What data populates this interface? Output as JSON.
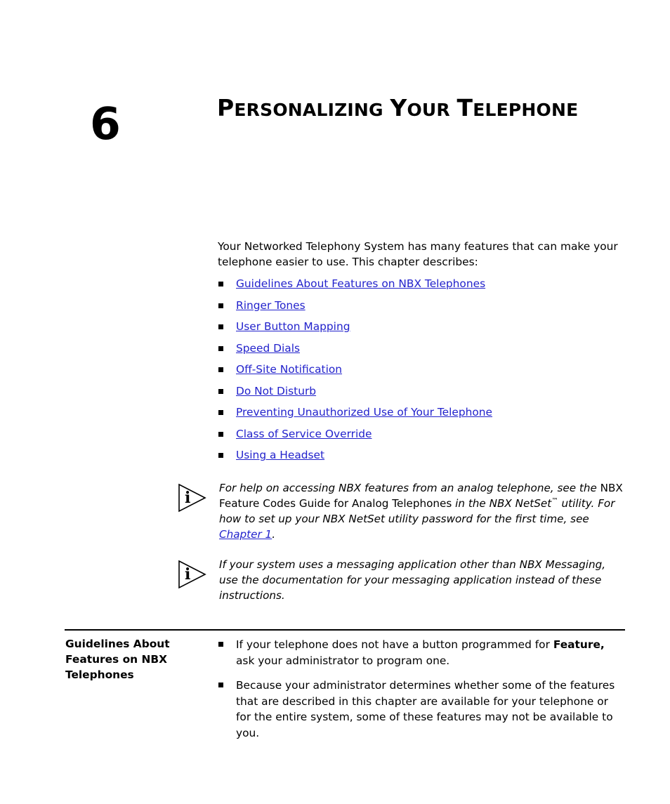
{
  "chapter": {
    "number": "6",
    "title_words": [
      {
        "cap": "P",
        "rest": "ERSONALIZING"
      },
      {
        "cap": "Y",
        "rest": "OUR"
      },
      {
        "cap": "T",
        "rest": "ELEPHONE"
      }
    ],
    "title_plain": "PERSONALIZING YOUR TELEPHONE"
  },
  "intro": {
    "paragraph": "Your Networked Telephony System has many features that can make your telephone easier to use. This chapter describes:"
  },
  "toc_links": [
    {
      "label": "Guidelines About Features on NBX Telephones"
    },
    {
      "label": "Ringer Tones"
    },
    {
      "label": "User Button Mapping"
    },
    {
      "label": "Speed Dials"
    },
    {
      "label": "Off-Site Notification"
    },
    {
      "label": "Do Not Disturb"
    },
    {
      "label": "Preventing Unauthorized Use of Your Telephone"
    },
    {
      "label": "Class of Service Override"
    },
    {
      "label": "Using a Headset"
    }
  ],
  "notes": [
    {
      "icon": "info-note-icon",
      "seg1": "For help on accessing NBX features from an analog telephone, see the ",
      "roman": "NBX Feature Codes Guide for Analog Telephones",
      "seg2": " in the NBX NetSet",
      "trademark": "™",
      "seg3": " utility. For how to set up your NBX NetSet utility password for the first time, see ",
      "link": "Chapter 1",
      "seg4": "."
    },
    {
      "icon": "info-note-icon",
      "seg1": "If your system uses a messaging application other than NBX Messaging, use the documentation for your messaging application instead of these instructions.",
      "roman": "",
      "seg2": "",
      "trademark": "",
      "seg3": "",
      "link": "",
      "seg4": ""
    }
  ],
  "section": {
    "heading": "Guidelines About Features on NBX Telephones",
    "bullets": [
      {
        "seg1": "If your telephone does not have a button programmed for ",
        "bold": "Feature,",
        "seg2": " ask your administrator to program one."
      },
      {
        "seg1": "Because your administrator determines whether some of the features that are described in this chapter are available for your telephone or for the entire system, some of these features may not be available to you.",
        "bold": "",
        "seg2": ""
      }
    ]
  },
  "colors": {
    "link": "#2222cc",
    "text": "#000000",
    "background": "#ffffff"
  }
}
